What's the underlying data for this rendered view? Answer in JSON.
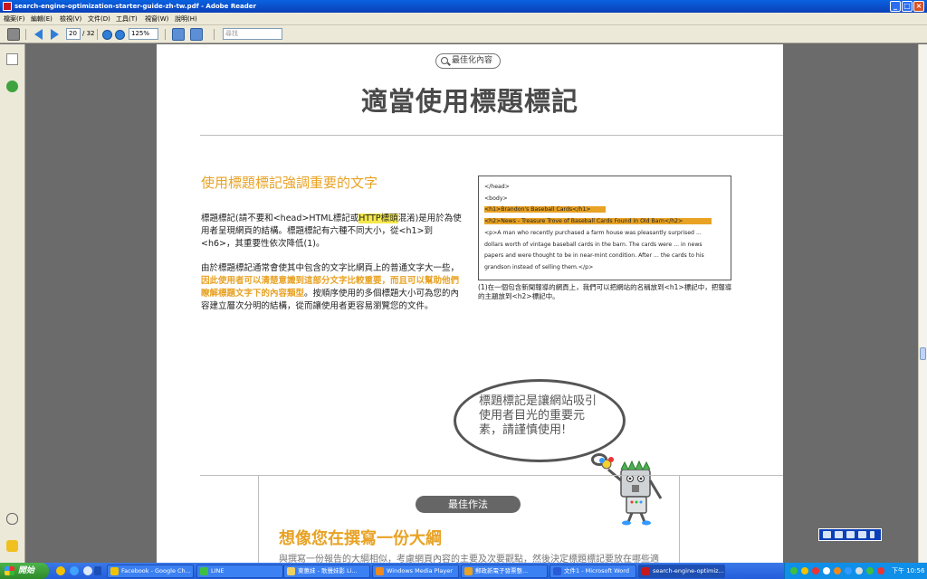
{
  "window": {
    "title": "search-engine-optimization-starter-guide-zh-tw.pdf - Adobe Reader"
  },
  "menu": {
    "items": [
      "檔案(F)",
      "編輯(E)",
      "檢視(V)",
      "文件(D)",
      "工具(T)",
      "視窗(W)",
      "說明(H)"
    ]
  },
  "toolbar": {
    "page_current": "20",
    "page_total": "/ 32",
    "zoom": "125%",
    "find_placeholder": "尋找"
  },
  "document": {
    "badge": "最佳化內容",
    "title": "適當使用標題標記",
    "section_heading": "使用標題標記強調重要的文字",
    "para1_a": "標題標記(請不要和<head>HTML標記或",
    "para1_hl": "HTTP標頭",
    "para1_b": "混淆)是用於為使用者呈現網頁的結構。標題標記有六種不同大小，從<h1>到<h6>，其重要性依次降低(1)。",
    "para2_a": "由於標題標記通常會使其中包含的文字比網頁上的普通文字大一些，",
    "para2_bold": "因此使用者可以清楚意識到這部分文字比較重要，而且可以幫助他們瞭解標題文字下的內容類型",
    "para2_b": "。按順序使用的多個標題大小可為您的內容建立層次分明的結構，從而讓使用者更容易瀏覽您的文件。",
    "code_lines": [
      {
        "text": "</head>",
        "highlight": false
      },
      {
        "text": "<body>",
        "highlight": false
      },
      {
        "text": "<h1>Brandon's Baseball Cards</h1>",
        "highlight": true
      },
      {
        "text": "<h2>News - Treasure Trove of Baseball Cards Found in Old Barn</h2>",
        "highlight": true
      },
      {
        "text": "<p>A man who recently purchased a farm house was pleasantly surprised ...",
        "highlight": false
      },
      {
        "text": "dollars worth of vintage baseball cards in the barn. The cards were ... in news",
        "highlight": false
      },
      {
        "text": "papers and were thought to be in near-mint condition. After ... the cards to his",
        "highlight": false
      },
      {
        "text": "grandson instead of selling them.</p>",
        "highlight": false
      }
    ],
    "caption": "(1)在一個包含新聞報導的網頁上，我們可以把網站的名稱放到<h1>標記中，把報導的主題放到<h2>標記中。",
    "bubble_text": "標題標記是讓網站吸引使用者目光的重要元素，請謹慎使用!",
    "best_practice": "最佳作法",
    "h3": "想像您在撰寫一份大綱",
    "para3": "與撰寫一份報告的大綱相似，考慮網頁內容的主要及次要觀點，然後決定標題標記要放在哪些適"
  },
  "taskbar": {
    "start": "開始",
    "tasks": [
      {
        "label": "Facebook - Google Ch...",
        "color": "#f2c200"
      },
      {
        "label": "LINE",
        "color": "#3fbf3f"
      },
      {
        "label": "東蕙妹 - 歌聲妹影 Li...",
        "color": "#f0d060"
      },
      {
        "label": "Windows Media Player",
        "color": "#f08a1c"
      },
      {
        "label": "郵政新電子發票整...",
        "color": "#e8a224"
      },
      {
        "label": "文件1 - Microsoft Word",
        "color": "#2a5bd7"
      },
      {
        "label": "search-engine-optimiz...",
        "color": "#c8161d"
      }
    ],
    "clock": "下午 10:56"
  }
}
